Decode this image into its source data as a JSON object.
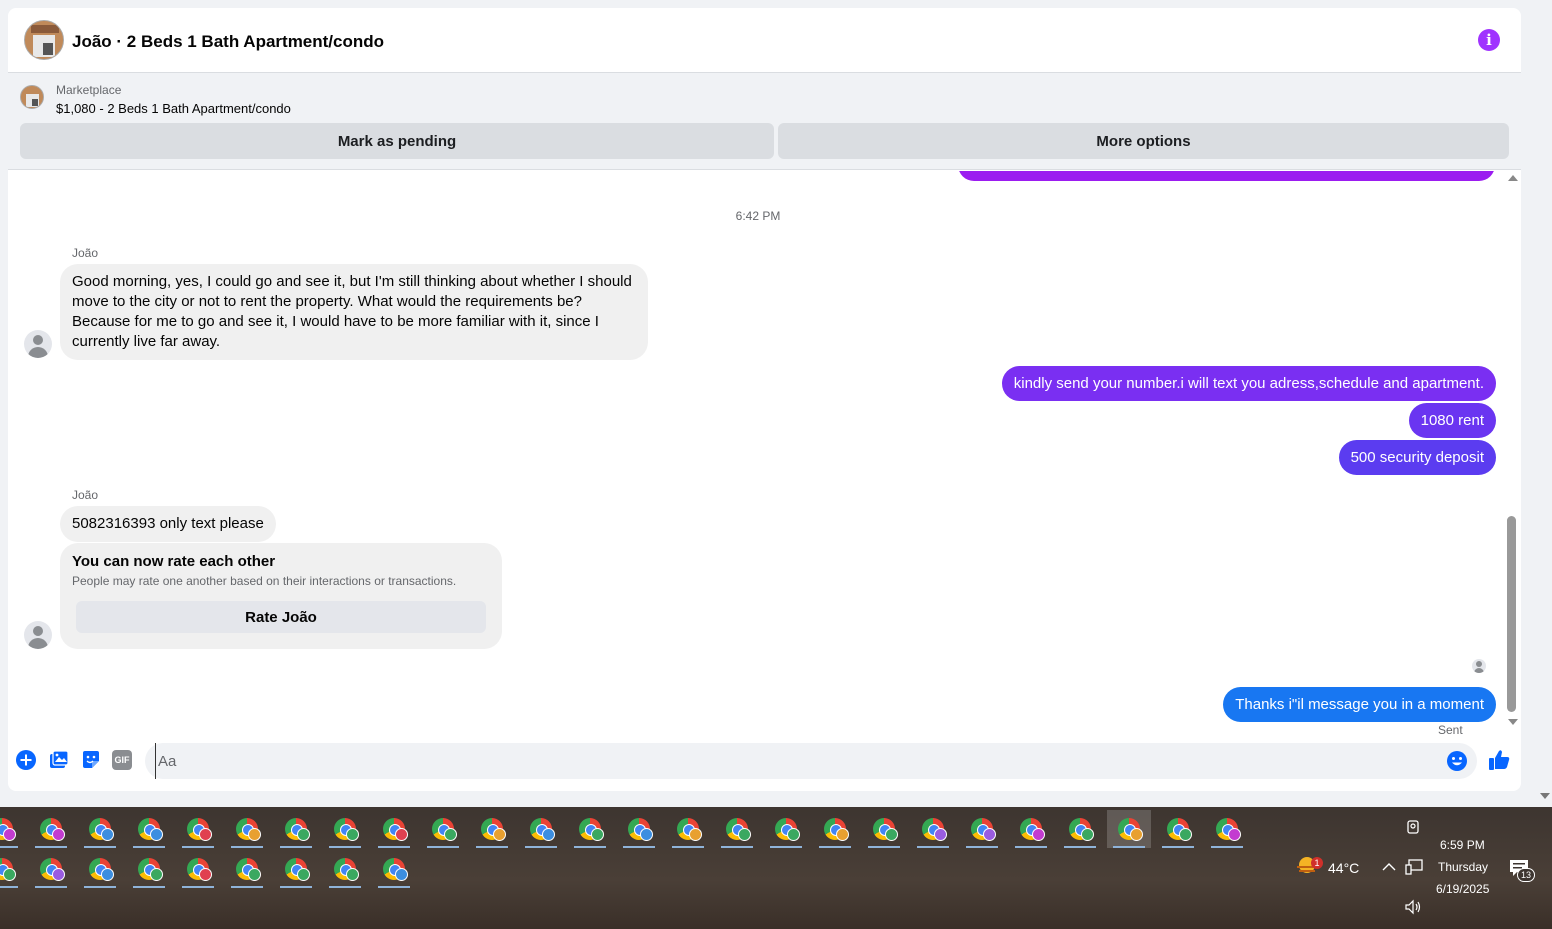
{
  "header": {
    "title": "João · 2 Beds 1 Bath Apartment/condo",
    "info_icon": "info-icon"
  },
  "banner": {
    "label": "Marketplace",
    "listing": "$1,080 - 2 Beds 1 Bath Apartment/condo",
    "mark_pending_label": "Mark as pending",
    "more_options_label": "More options"
  },
  "thread": {
    "timestamp": "6:42 PM",
    "sender_name": "João",
    "msg1": "Good morning, yes, I could go and see it, but I'm still thinking about whether I should move to the city or not to rent the property. What would the requirements be? Because for me to go and see it, I would have to be more familiar with it, since I currently live far away.",
    "out1": "kindly send your number.i will text you adress,schedule and apartment.",
    "out2": "1080 rent",
    "out3": "500 security deposit",
    "msg2": "5082316393 only text please",
    "rate_title": "You can now rate each other",
    "rate_sub": "People may rate one another based on their interactions or transactions.",
    "rate_button": "Rate João",
    "out4": "Thanks i\"il message you in a moment",
    "sent_status": "Sent",
    "colors": {
      "purple": "#9b1cf0",
      "violet": "#7a2ff2",
      "indigo": "#5b3cf0",
      "blue": "#1877f2"
    }
  },
  "composer": {
    "placeholder": "Aa",
    "icons": [
      "plus-icon",
      "image-icon",
      "sticker-icon",
      "gif-icon",
      "emoji-icon",
      "thumbs-up-icon"
    ],
    "gif_label": "GIF"
  },
  "taskbar": {
    "temperature": "44°C",
    "weather_badge": "1",
    "time": "6:59 PM",
    "day": "Thursday",
    "date": "6/19/2025",
    "notifications": "13",
    "row1_badges": [
      "#c33cd0",
      "#c33cd0",
      "#3c8ee0",
      "#3c8ee0",
      "#e04050",
      "#e8a030",
      "#3aa860",
      "#3aa860",
      "#e04050",
      "#3aa860",
      "#e8a030",
      "#3c8ee0",
      "#3aa860",
      "#3c8ee0",
      "#e8a030",
      "#3aa860",
      "#3aa860",
      "#e8a030",
      "#3aa860",
      "#9a5ce0",
      "#9a5ce0",
      "#c33cd0",
      "#3aa860",
      "#e8a030",
      "#3aa860",
      "#c33cd0"
    ],
    "row2_badges": [
      "#3aa860",
      "#9a5ce0",
      "#3c8ee0",
      "#3aa860",
      "#e04050",
      "#3aa860",
      "#3aa860",
      "#3aa860",
      "#3c8ee0"
    ]
  }
}
